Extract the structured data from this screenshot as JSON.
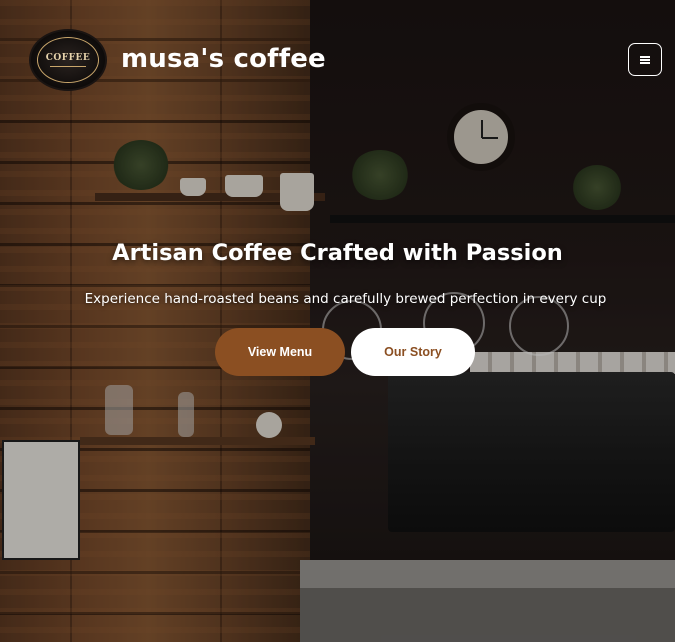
{
  "header": {
    "logo_text": "COFFEE",
    "brand_name": "musa's coffee",
    "menu_icon": "hamburger-menu-icon"
  },
  "hero": {
    "title": "Artisan Coffee Crafted with Passion",
    "subtitle": "Experience hand-roasted beans and carefully brewed perfection in every cup",
    "buttons": {
      "primary_label": "View Menu",
      "secondary_label": "Our Story"
    }
  },
  "colors": {
    "accent": "#8b4f22",
    "button_light": "#ffffff",
    "text": "#ffffff"
  }
}
